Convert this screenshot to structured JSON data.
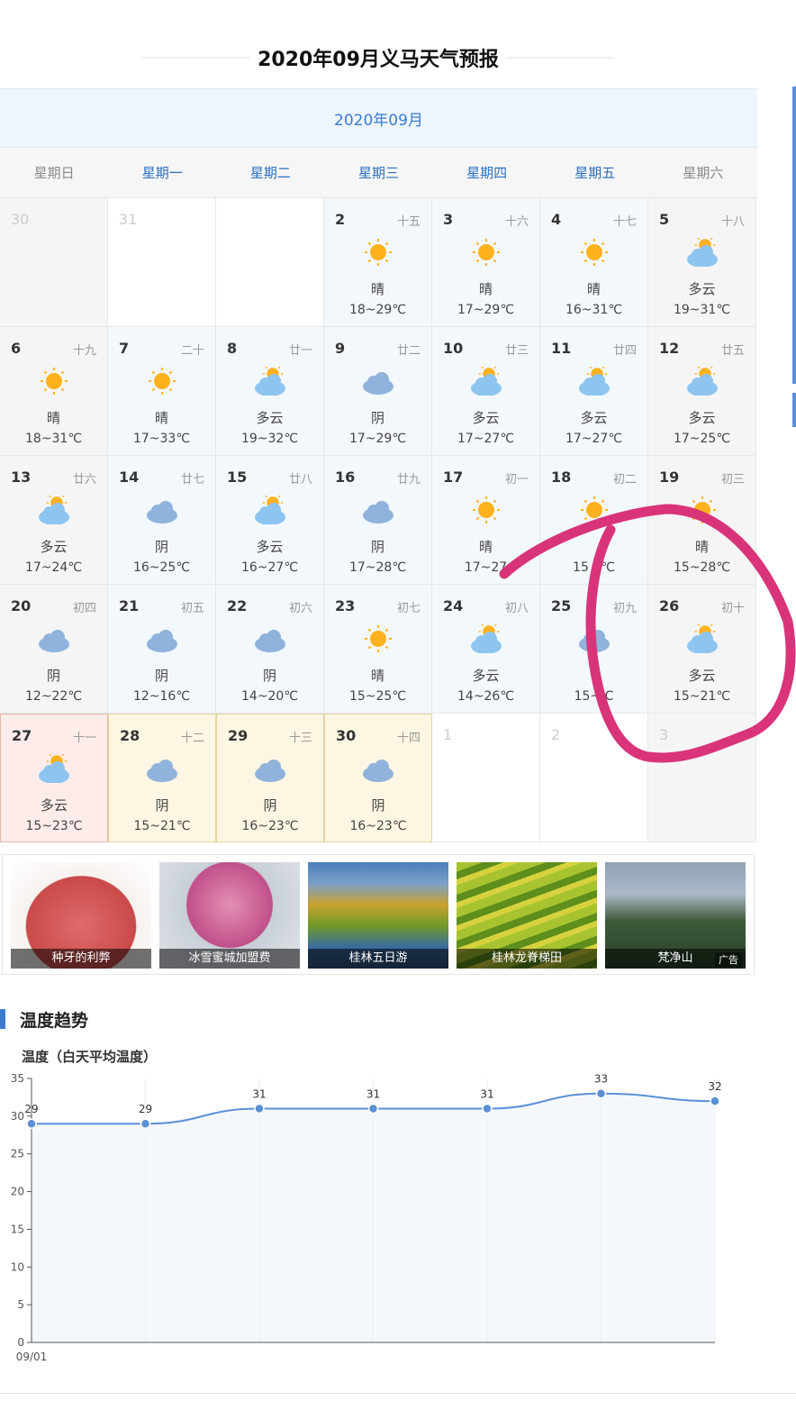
{
  "title": "2020年09月义马天气预报",
  "calendar": {
    "month_label": "2020年09月",
    "weekdays": [
      "星期日",
      "星期一",
      "星期二",
      "星期三",
      "星期四",
      "星期五",
      "星期六"
    ],
    "cells": [
      {
        "date": "30",
        "other": true
      },
      {
        "date": "31",
        "other": true
      },
      {
        "blank": true
      },
      {
        "date": "2",
        "lunar": "十五",
        "weather": "晴",
        "temp": "18~29℃",
        "icon": "sunny-icon"
      },
      {
        "date": "3",
        "lunar": "十六",
        "weather": "晴",
        "temp": "17~29℃",
        "icon": "sunny-icon"
      },
      {
        "date": "4",
        "lunar": "十七",
        "weather": "晴",
        "temp": "16~31℃",
        "icon": "sunny-icon"
      },
      {
        "date": "5",
        "lunar": "十八",
        "weather": "多云",
        "temp": "19~31℃",
        "icon": "partly-cloudy-icon"
      },
      {
        "date": "6",
        "lunar": "十九",
        "weather": "晴",
        "temp": "18~31℃",
        "icon": "sunny-icon"
      },
      {
        "date": "7",
        "lunar": "二十",
        "weather": "晴",
        "temp": "17~33℃",
        "icon": "sunny-icon"
      },
      {
        "date": "8",
        "lunar": "廿一",
        "weather": "多云",
        "temp": "19~32℃",
        "icon": "partly-cloudy-icon"
      },
      {
        "date": "9",
        "lunar": "廿二",
        "weather": "阴",
        "temp": "17~29℃",
        "icon": "cloudy-icon"
      },
      {
        "date": "10",
        "lunar": "廿三",
        "weather": "多云",
        "temp": "17~27℃",
        "icon": "partly-cloudy-icon"
      },
      {
        "date": "11",
        "lunar": "廿四",
        "weather": "多云",
        "temp": "17~27℃",
        "icon": "partly-cloudy-icon"
      },
      {
        "date": "12",
        "lunar": "廿五",
        "weather": "多云",
        "temp": "17~25℃",
        "icon": "partly-cloudy-icon"
      },
      {
        "date": "13",
        "lunar": "廿六",
        "weather": "多云",
        "temp": "17~24℃",
        "icon": "partly-cloudy-icon"
      },
      {
        "date": "14",
        "lunar": "廿七",
        "weather": "阴",
        "temp": "16~25℃",
        "icon": "cloudy-icon"
      },
      {
        "date": "15",
        "lunar": "廿八",
        "weather": "多云",
        "temp": "16~27℃",
        "icon": "partly-cloudy-icon"
      },
      {
        "date": "16",
        "lunar": "廿九",
        "weather": "阴",
        "temp": "17~28℃",
        "icon": "cloudy-icon"
      },
      {
        "date": "17",
        "lunar": "初一",
        "weather": "晴",
        "temp": "17~27",
        "icon": "sunny-icon"
      },
      {
        "date": "18",
        "lunar": "初二",
        "weather": "",
        "temp": "15 0℃",
        "icon": "sunny-icon"
      },
      {
        "date": "19",
        "lunar": "初三",
        "weather": "晴",
        "temp": "15~28℃",
        "icon": "sunny-icon"
      },
      {
        "date": "20",
        "lunar": "初四",
        "weather": "阴",
        "temp": "12~22℃",
        "icon": "cloudy-icon"
      },
      {
        "date": "21",
        "lunar": "初五",
        "weather": "阴",
        "temp": "12~16℃",
        "icon": "cloudy-icon"
      },
      {
        "date": "22",
        "lunar": "初六",
        "weather": "阴",
        "temp": "14~20℃",
        "icon": "cloudy-icon"
      },
      {
        "date": "23",
        "lunar": "初七",
        "weather": "晴",
        "temp": "15~25℃",
        "icon": "sunny-icon"
      },
      {
        "date": "24",
        "lunar": "初八",
        "weather": "多云",
        "temp": "14~26℃",
        "icon": "partly-cloudy-icon"
      },
      {
        "date": "25",
        "lunar": "初九",
        "weather": "",
        "temp": "15~ C",
        "icon": "cloudy-icon"
      },
      {
        "date": "26",
        "lunar": "初十",
        "weather": "多云",
        "temp": "15~21℃",
        "icon": "partly-cloudy-icon"
      },
      {
        "date": "27",
        "lunar": "十一",
        "weather": "多云",
        "temp": "15~23℃",
        "icon": "partly-cloudy-icon",
        "state": "today"
      },
      {
        "date": "28",
        "lunar": "十二",
        "weather": "阴",
        "temp": "15~21℃",
        "icon": "cloudy-icon",
        "state": "future"
      },
      {
        "date": "29",
        "lunar": "十三",
        "weather": "阴",
        "temp": "16~23℃",
        "icon": "cloudy-icon",
        "state": "future"
      },
      {
        "date": "30",
        "lunar": "十四",
        "weather": "阴",
        "temp": "16~23℃",
        "icon": "cloudy-icon",
        "state": "future"
      },
      {
        "date": "1",
        "other": true
      },
      {
        "date": "2",
        "other": true
      },
      {
        "date": "3",
        "other": true
      }
    ]
  },
  "ads": [
    {
      "caption": "种牙的利弊"
    },
    {
      "caption": "冰雪蜜城加盟费"
    },
    {
      "caption": "桂林五日游"
    },
    {
      "caption": "桂林龙脊梯田"
    },
    {
      "caption": "梵净山"
    }
  ],
  "ad_badge": "广告",
  "trend": {
    "heading": "温度趋势",
    "chart_title": "温度（白天平均温度）"
  },
  "chart_data": {
    "type": "line",
    "x": [
      "09/01",
      "",
      "",
      "",
      "",
      "",
      ""
    ],
    "values": [
      29,
      29,
      31,
      31,
      31,
      33,
      32
    ],
    "ylim": [
      0,
      35
    ],
    "yticks": [
      0,
      5,
      10,
      15,
      20,
      25,
      30,
      35
    ],
    "grid": true,
    "line_color": "#5b8fd6"
  },
  "annotation_color": "#d9347a"
}
